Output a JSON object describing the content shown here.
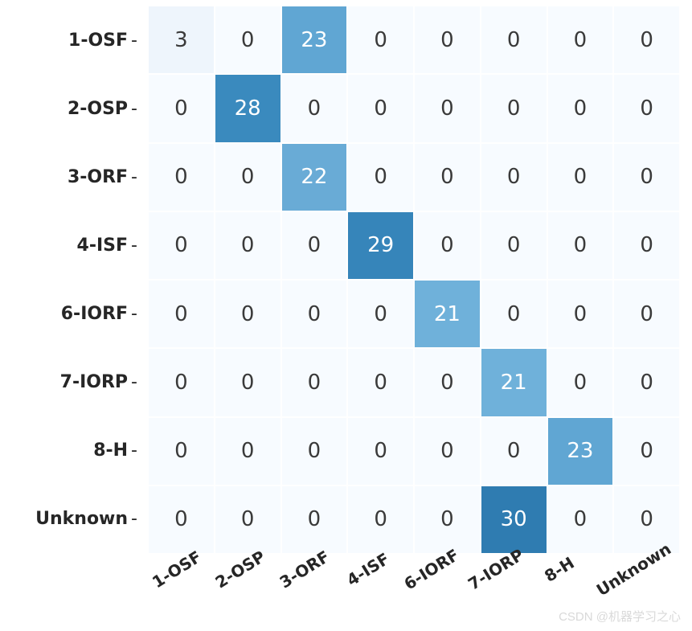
{
  "chart_data": {
    "type": "heatmap",
    "title": "",
    "xlabel": "",
    "ylabel": "",
    "row_labels": [
      "1-OSF",
      "2-OSP",
      "3-ORF",
      "4-ISF",
      "6-IORF",
      "7-IORP",
      "8-H",
      "Unknown"
    ],
    "col_labels": [
      "1-OSF",
      "2-OSP",
      "3-ORF",
      "4-ISF",
      "6-IORF",
      "7-IORP",
      "8-H",
      "Unknown"
    ],
    "matrix": [
      [
        3,
        0,
        23,
        0,
        0,
        0,
        0,
        0
      ],
      [
        0,
        28,
        0,
        0,
        0,
        0,
        0,
        0
      ],
      [
        0,
        0,
        22,
        0,
        0,
        0,
        0,
        0
      ],
      [
        0,
        0,
        0,
        29,
        0,
        0,
        0,
        0
      ],
      [
        0,
        0,
        0,
        0,
        21,
        0,
        0,
        0
      ],
      [
        0,
        0,
        0,
        0,
        0,
        21,
        0,
        0
      ],
      [
        0,
        0,
        0,
        0,
        0,
        0,
        23,
        0
      ],
      [
        0,
        0,
        0,
        0,
        0,
        30,
        0,
        0
      ]
    ],
    "value_range": [
      0,
      30
    ],
    "colormap": "Blues"
  },
  "watermark": "CSDN @机器学习之心"
}
